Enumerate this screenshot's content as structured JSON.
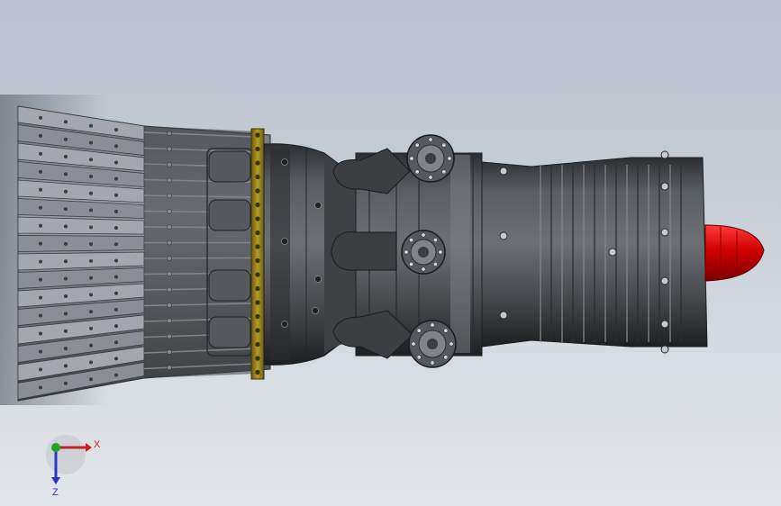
{
  "viewport": {
    "background_top": "#b8c1cd",
    "background_bottom": "#e2e5e9",
    "model": {
      "body_color": "#4a4c50",
      "nose_cone_color": "#cc0000",
      "flange_color": "#8f7b1c"
    }
  },
  "triad": {
    "x_label": "X",
    "z_label": "Z",
    "x_color": "#cc1f1f",
    "y_color": "#21a324",
    "z_color": "#2a36c8"
  }
}
